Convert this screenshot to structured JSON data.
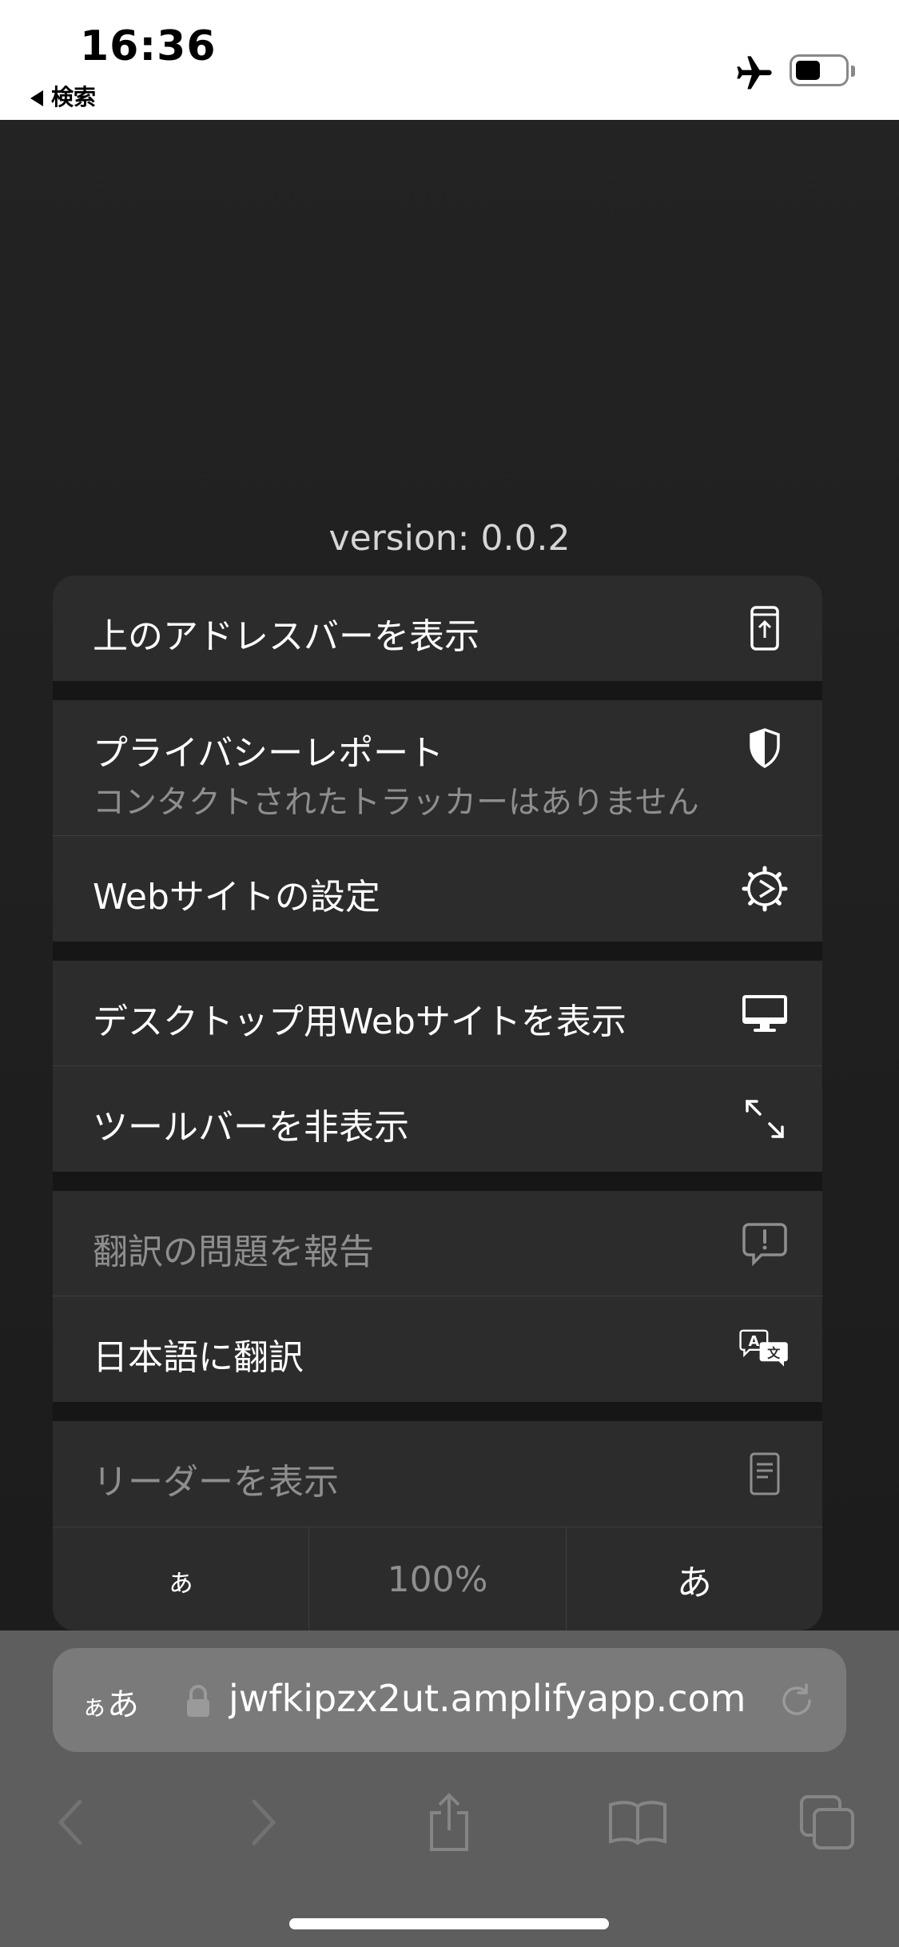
{
  "status_bar": {
    "time": "16:36",
    "back_label": "検索"
  },
  "page": {
    "version_text": "version: 0.0.2"
  },
  "menu": {
    "show_top_address_bar": "上のアドレスバーを表示",
    "privacy_report": {
      "title": "プライバシーレポート",
      "subtitle": "コンタクトされたトラッカーはありません"
    },
    "website_settings": "Webサイトの設定",
    "desktop_site": "デスクトップ用Webサイトを表示",
    "hide_toolbar": "ツールバーを非表示",
    "report_translation_issue": "翻訳の問題を報告",
    "translate_japanese": "日本語に翻訳",
    "show_reader": "リーダーを表示",
    "zoom": {
      "decrease": "ぁ",
      "level": "100%",
      "increase": "あ"
    }
  },
  "address_bar": {
    "aa_small": "ぁ",
    "aa_large": "あ",
    "url": "jwfkipzx2ut.amplifyapp.com"
  },
  "colors": {
    "menu_bg": "#2c2c2c",
    "dim_text": "#8e8e8e",
    "toolbar_bg": "#5e5e5e"
  }
}
